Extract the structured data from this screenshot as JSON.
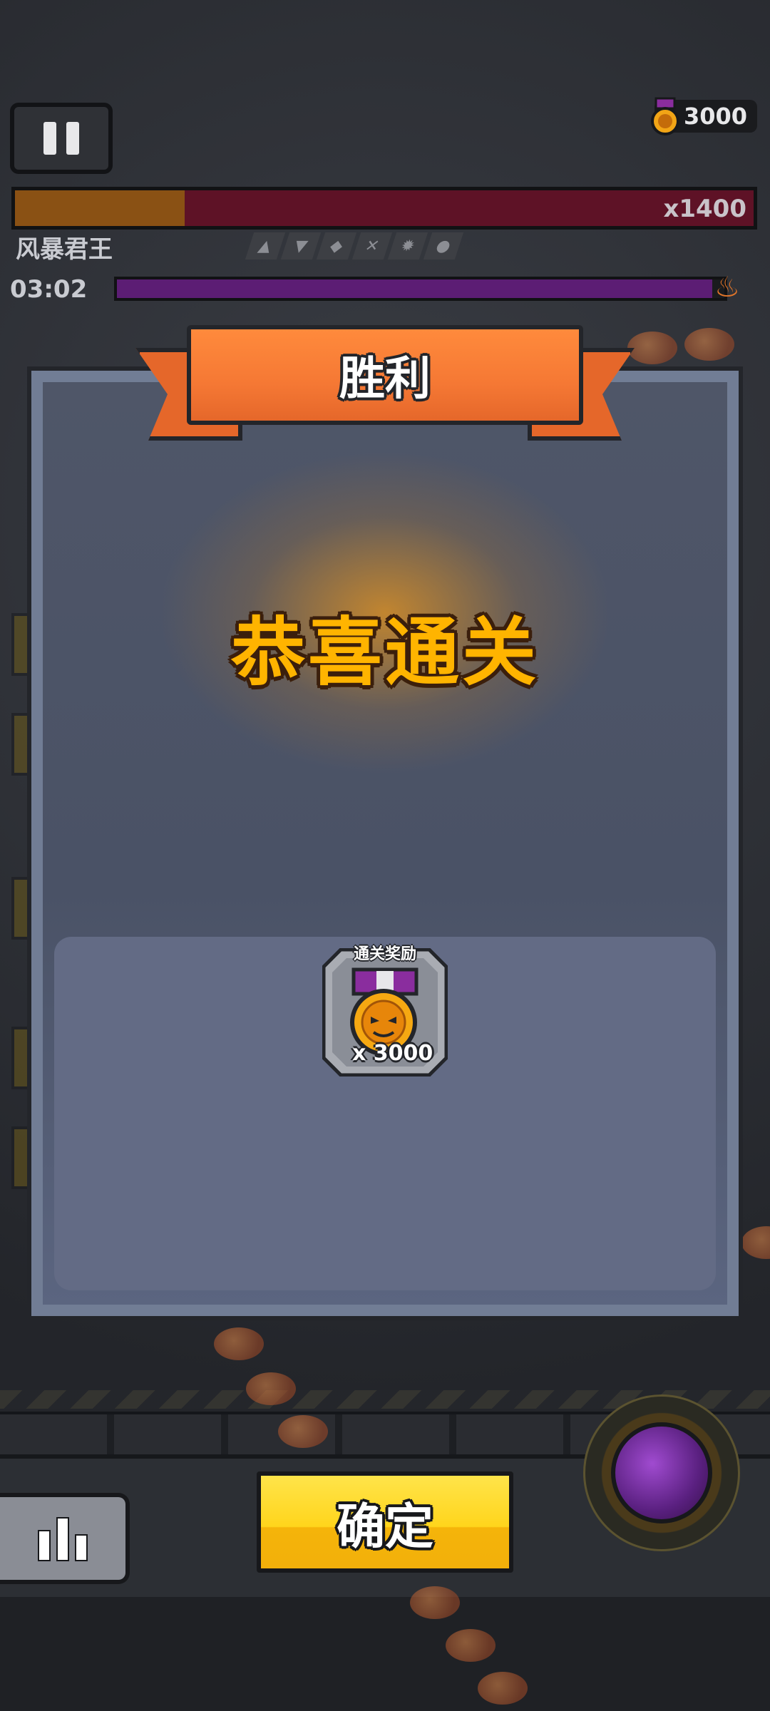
{
  "hud": {
    "medal_count": "3000",
    "boss": {
      "multiplier": "x1400",
      "name": "风暴君王",
      "hp_fraction": 0.23
    },
    "timer": "03:02",
    "wave_progress": 0.98
  },
  "dialog": {
    "title": "胜利",
    "message": "恭喜通关",
    "reward": {
      "label": "通关奖励",
      "count": "x 3000",
      "icon": "medal-icon"
    }
  },
  "buttons": {
    "confirm": "确定",
    "stats_icon": "bar-chart-icon",
    "pause_icon": "pause-icon",
    "ability_icon": "ability-orb-icon"
  },
  "colors": {
    "accent_orange": "#f57834",
    "confirm_yellow": "#ffd51c",
    "congrats_gold": "#ffb400",
    "boss_hp": "#6b1328",
    "wave_purple": "#5c1d74"
  }
}
